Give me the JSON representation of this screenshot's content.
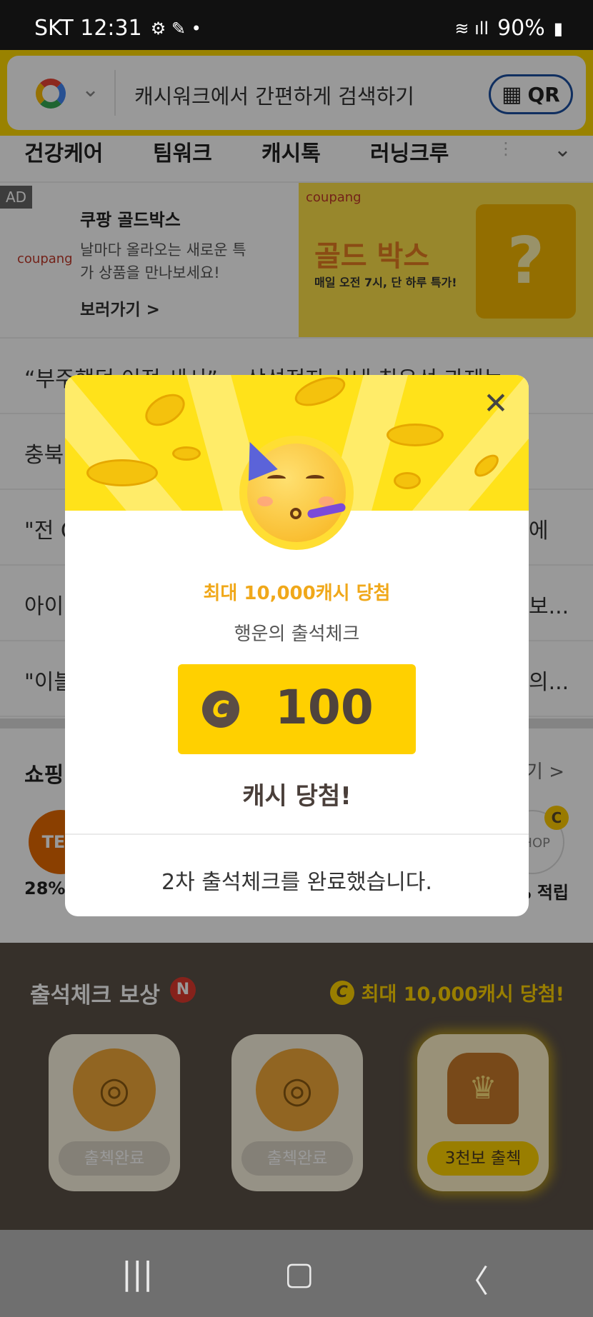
{
  "status_bar": {
    "carrier_time": "SKT 12:31",
    "battery": "90%"
  },
  "search": {
    "placeholder": "캐시워크에서 간편하게 검색하기",
    "qr_label": "QR"
  },
  "tabs": [
    "건강케어",
    "팀워크",
    "캐시톡",
    "러닝크루"
  ],
  "ad": {
    "badge": "AD",
    "brand": "coupang",
    "title": "쿠팡 골드박스",
    "description": "날마다 올라오는 새로운 특가 상품을 만나보세요!",
    "link": "보러가기 >",
    "banner_title": "골드 박스",
    "banner_sub": "매일 오전 7시, 단 하루 특가!"
  },
  "news": [
    "“부주했던 이전 세시”… 삼성전자 사내 최우선 과제는",
    "충북",
    "\"전 C",
    "아이",
    "\"이블"
  ],
  "news_tails": [
    "",
    "",
    "에",
    "보...",
    "의..."
  ],
  "shopping": {
    "title": "쇼핑",
    "more": "기 >",
    "ten_label": "TEN",
    "rate_left": "28%",
    "shop_label": "SHOP",
    "rate_right": "% 적립"
  },
  "attendance": {
    "title": "출석체크 보상",
    "badge": "N",
    "promo": "최대 10,000캐시 당첨!",
    "cards": [
      {
        "label": "출첵완료"
      },
      {
        "label": "출첵완료"
      },
      {
        "label": "3천보 출첵"
      }
    ]
  },
  "modal": {
    "headline": "최대 10,000캐시 당첨",
    "subtitle": "행운의 출석체크",
    "reward_amount": "100",
    "result": "캐시 당첨!",
    "footer": "2차 출석체크를 완료했습니다."
  },
  "colors": {
    "brand_yellow": "#ffd900",
    "headline_orange": "#f0a81a",
    "attendance_bg": "#5a5047"
  }
}
